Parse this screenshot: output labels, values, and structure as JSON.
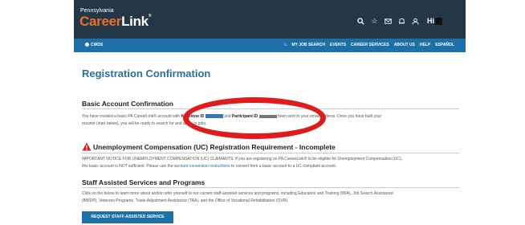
{
  "header": {
    "logo_small": "Pennsylvania",
    "logo_big_prefix": "Career",
    "logo_big_suffix": "Link",
    "logo_mark": "®",
    "icons": [
      "search-icon",
      "star-icon",
      "mail-icon",
      "bell-icon",
      "user-icon"
    ],
    "greeting": "Hi"
  },
  "nav": {
    "cwds": "CWDS",
    "links": [
      "MY JOB SEARCH",
      "EVENTS",
      "CAREER SERVICES",
      "ABOUT US",
      "HELP",
      "ESPAÑOL"
    ]
  },
  "page": {
    "title": "Registration Confirmation",
    "basic": {
      "heading": "Basic Account Confirmation",
      "text_1": "You have created a basic PA CareerLink® account with",
      "keystone_label": "Keystone ID",
      "text_2": "and",
      "participant_label": "Participant ID",
      "text_3": "been sent to your email address. Once you have built your",
      "text_4": "resume (start below), you will be ready to search for and apply to jobs."
    },
    "uc": {
      "heading": "Unemployment Compensation (UC) Registration Requirement - Incomplete",
      "text_1": "IMPORTANT NOTICE FOR UNEMPLOYMENT COMPENSATION (UC) CLAIMANTS: If you are registering on PA CareerLink® to be eligible for Unemployment Compensation (UC),",
      "text_2": "this basic account is NOT sufficient. Please use the",
      "link": "account conversion instructions",
      "text_3": "to convert from a basic account to a UC-compliant account."
    },
    "staff": {
      "heading": "Staff Assisted Services and Programs",
      "text_1": "Click on the below to learn more about and/or refer yourself to our current staff-assisted services and programs, including Education and Training (WIA), Job Search Assistance",
      "text_2": "(BWDP), Veterans Programs, Trade Adjustment Assistance (TAA), and the Office of Vocational Rehabilitation (OVR).",
      "button": "REQUEST STAFF-ASSISTED SERVICE"
    }
  },
  "colors": {
    "header_bg": "#243746",
    "nav_bg": "#1d6fa8",
    "title": "#2a6f9e",
    "warning_red": "#d62020",
    "annotation_red": "#e01b1b"
  }
}
